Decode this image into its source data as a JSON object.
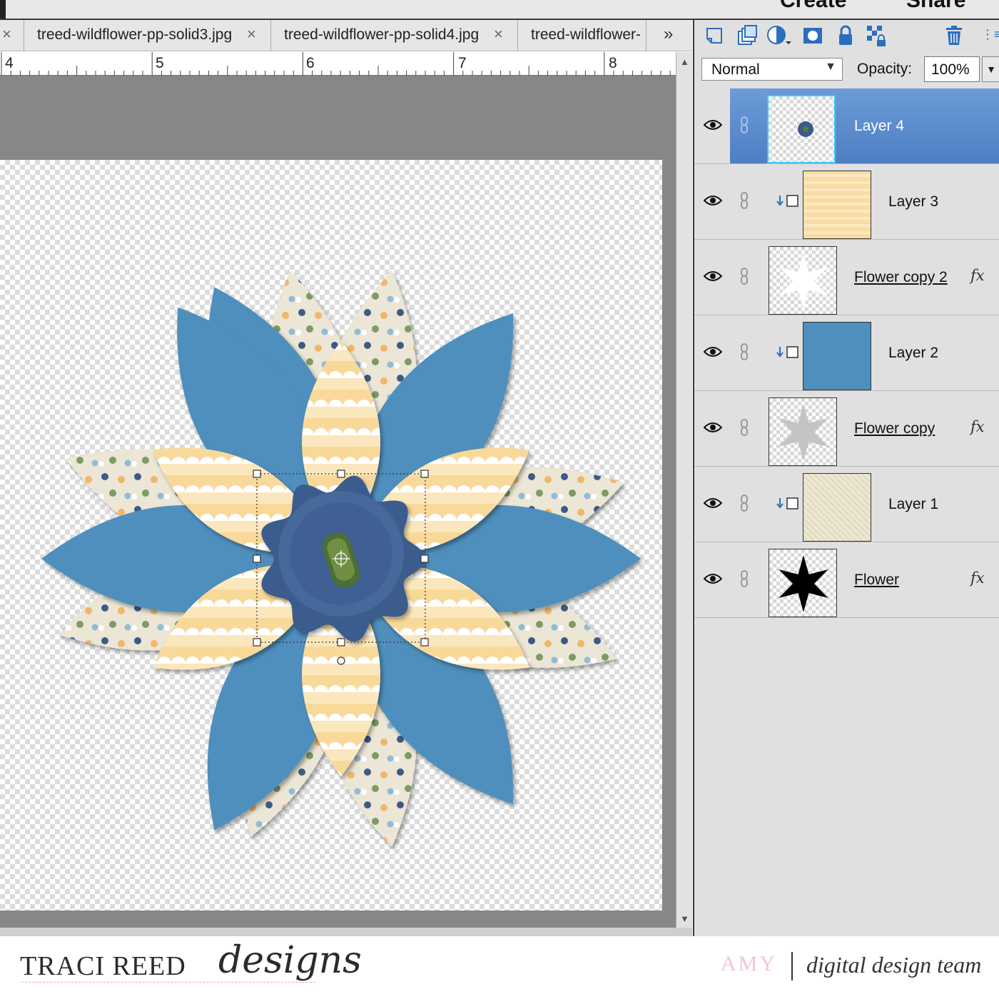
{
  "menu": {
    "create": "Create",
    "share": "Share"
  },
  "tabs": [
    {
      "label": "treed-wildflower-pp-solid3.jpg"
    },
    {
      "label": "treed-wildflower-pp-solid4.jpg"
    },
    {
      "label": "treed-wildflower-"
    }
  ],
  "tab_close_glyph": "×",
  "tabs_more_glyph": "»",
  "ruler": {
    "numbers": [
      "4",
      "5",
      "6",
      "7",
      "8"
    ]
  },
  "layers_panel": {
    "blend_mode": "Normal",
    "opacity_label": "Opacity:",
    "opacity_value": "100%",
    "toolbar_icons": [
      "new-layer-icon",
      "new-group-icon",
      "adjustment-layer-icon",
      "layer-mask-icon",
      "lock-all-icon",
      "lock-transparency-icon",
      "delete-layer-icon",
      "panel-menu-icon"
    ],
    "layers": [
      {
        "name": "Layer 4",
        "selected": true,
        "clipped": false,
        "fx": "",
        "thumb": "button"
      },
      {
        "name": "Layer 3",
        "selected": false,
        "clipped": true,
        "fx": "",
        "thumb": "yellow-paper"
      },
      {
        "name": "Flower copy 2",
        "selected": false,
        "clipped": false,
        "fx": "fx",
        "thumb": "white-star"
      },
      {
        "name": "Layer 2",
        "selected": false,
        "clipped": true,
        "fx": "",
        "thumb": "blue-paper"
      },
      {
        "name": "Flower copy",
        "selected": false,
        "clipped": false,
        "fx": "fx",
        "thumb": "gray-star"
      },
      {
        "name": "Layer 1",
        "selected": false,
        "clipped": true,
        "fx": "",
        "thumb": "cream-paper"
      },
      {
        "name": "Flower",
        "selected": false,
        "clipped": false,
        "fx": "fx",
        "thumb": "black-star"
      }
    ]
  },
  "footer": {
    "brand_name": "TRACI REED",
    "brand_script": "designs",
    "designer": "AMY",
    "team": "digital design team"
  },
  "colors": {
    "petal_blue": "#4f8fbd",
    "petal_yellow": "#f9d99a",
    "petal_cream": "#ebe6d5",
    "center_navy": "#3b5b8c",
    "selection_blue": "#5a8ccc"
  }
}
